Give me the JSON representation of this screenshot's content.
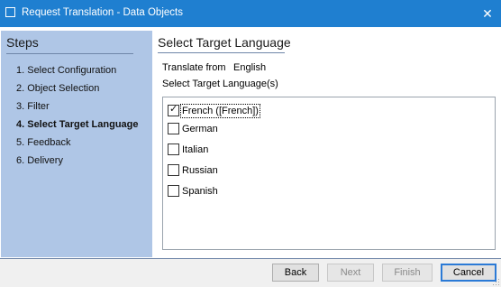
{
  "window": {
    "title": "Request Translation - Data Objects",
    "close_glyph": "✕"
  },
  "colors": {
    "titlebar": "#1f7fd0",
    "steps_panel": "#afc6e6",
    "accent_rule": "#6f86a8",
    "default_button_border": "#2b7ad6"
  },
  "steps": {
    "title": "Steps",
    "items": [
      {
        "label": "1. Select Configuration",
        "current": false
      },
      {
        "label": "2. Object Selection",
        "current": false
      },
      {
        "label": "3. Filter",
        "current": false
      },
      {
        "label": "4. Select Target Language",
        "current": true
      },
      {
        "label": "5. Feedback",
        "current": false
      },
      {
        "label": "6. Delivery",
        "current": false
      }
    ]
  },
  "content": {
    "title": "Select Target Language",
    "translate_from_label": "Translate from",
    "translate_from_value": "English",
    "target_label": "Select Target Language(s)",
    "languages": [
      {
        "label": "French ([French])",
        "checked": true
      },
      {
        "label": "German",
        "checked": false
      },
      {
        "label": "Italian",
        "checked": false
      },
      {
        "label": "Russian",
        "checked": false
      },
      {
        "label": "Spanish",
        "checked": false
      }
    ]
  },
  "buttons": {
    "back": "Back",
    "next": "Next",
    "finish": "Finish",
    "cancel": "Cancel"
  },
  "icons": {
    "app": "window-icon",
    "close": "close-icon",
    "check": "checkmark-icon",
    "grip": "resize-grip-icon"
  }
}
